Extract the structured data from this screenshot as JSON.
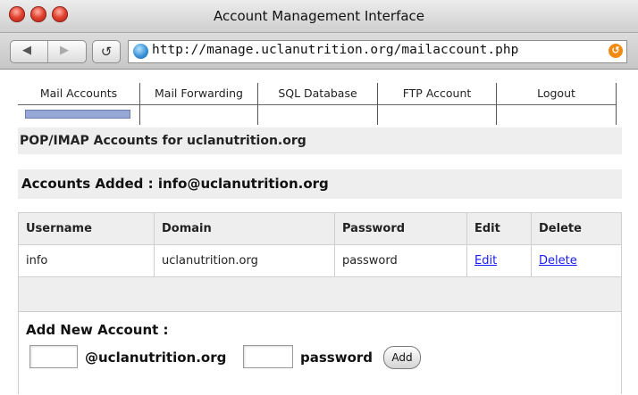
{
  "window": {
    "title": "Account Management Interface"
  },
  "browser": {
    "url": "http://manage.uclanutrition.org/mailaccount.php"
  },
  "nav": {
    "tabs": [
      {
        "label": "Mail Accounts",
        "active": true
      },
      {
        "label": "Mail Forwarding"
      },
      {
        "label": "SQL Database"
      },
      {
        "label": "FTP Account"
      },
      {
        "label": "Logout"
      }
    ]
  },
  "section_title": "POP/IMAP Accounts for uclanutrition.org",
  "accounts_added_title": "Accounts Added : info@uclanutrition.org",
  "table": {
    "headers": [
      "Username",
      "Domain",
      "Password",
      "Edit",
      "Delete"
    ],
    "rows": [
      {
        "username": "info",
        "domain": "uclanutrition.org",
        "password": "password",
        "edit": "Edit",
        "delete": "Delete"
      }
    ]
  },
  "add_form": {
    "title": "Add New Account :",
    "username_value": "",
    "domain_suffix": "@uclanutrition.org",
    "password_value": "",
    "password_label": "password",
    "button": "Add"
  },
  "colors": {
    "active_tab_marker": "#97a8d8",
    "section_bg": "#eeeeee",
    "link": "#1a1aee"
  }
}
